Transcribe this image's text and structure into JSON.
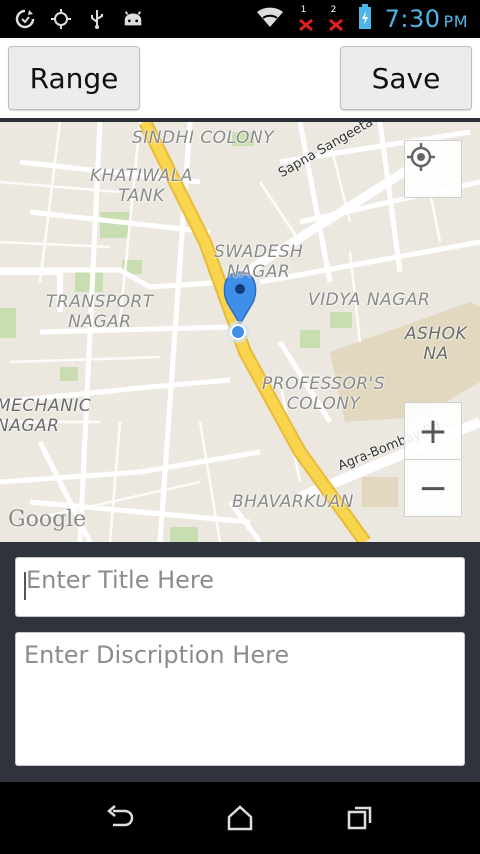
{
  "status_bar": {
    "time": "7:30",
    "ampm": "PM",
    "sim1": "1",
    "sim2": "2",
    "icons": [
      "sync-icon",
      "gps-icon",
      "usb-icon",
      "android-icon",
      "wifi-icon",
      "signal-icon",
      "signal-icon",
      "battery-icon"
    ]
  },
  "toolbar": {
    "range_label": "Range",
    "save_label": "Save"
  },
  "map": {
    "labels": {
      "sindhi": "SINDHI COLONY",
      "khatiwala": "KHATIWALA\nTANK",
      "swadesh": "SWADESH\nNAGAR",
      "transport": "TRANSPORT\nNAGAR",
      "vidya": "VIDYA NAGAR",
      "ashok": "ASHOK NA",
      "professors": "PROFESSOR'S\nCOLONY",
      "mechanic": "MECHANIC\nNAGAR",
      "bhavarkuan": "BHAVARKUAN",
      "sapna_rd": "Sapna Sangeeta Rd",
      "agra_rd": "Agra-Bombay Rd"
    },
    "attribution": "Google",
    "zoom_in": "+",
    "zoom_out": "−"
  },
  "form": {
    "title_placeholder": "Enter Title Here",
    "description_placeholder": "Enter Discription Here"
  },
  "colors": {
    "accent": "#4db6e8",
    "major_road": "#f9d54e",
    "marker": "#3f8ee9",
    "panel": "#2f343c"
  }
}
